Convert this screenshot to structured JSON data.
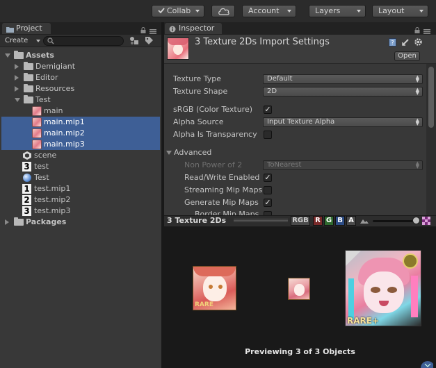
{
  "toolbar": {
    "collab_label": "Collab",
    "account_label": "Account",
    "layers_label": "Layers",
    "layout_label": "Layout",
    "colors": {
      "bg": "#2b2b2b",
      "button": "#4f4f4f"
    }
  },
  "project": {
    "tab_label": "Project",
    "create_label": "Create",
    "search": {
      "value": "",
      "placeholder": ""
    },
    "tree": [
      {
        "label": "Assets",
        "kind": "folder",
        "bold": true,
        "expanded": true
      },
      {
        "label": "Demigiant",
        "kind": "folder",
        "expanded": false
      },
      {
        "label": "Editor",
        "kind": "folder",
        "expanded": false
      },
      {
        "label": "Resources",
        "kind": "folder",
        "expanded": false
      },
      {
        "label": "Test",
        "kind": "folder",
        "expanded": true
      },
      {
        "label": "main",
        "kind": "texture",
        "selected": false
      },
      {
        "label": "main.mip1",
        "kind": "texture",
        "selected": true
      },
      {
        "label": "main.mip2",
        "kind": "texture",
        "selected": true
      },
      {
        "label": "main.mip3",
        "kind": "texture",
        "selected": true
      },
      {
        "label": "scene",
        "kind": "scene-icon"
      },
      {
        "label": "test",
        "kind": "number-icon",
        "glyph": "3"
      },
      {
        "label": "Test",
        "kind": "sphere-icon"
      },
      {
        "label": "test.mip1",
        "kind": "number-icon",
        "glyph": "1"
      },
      {
        "label": "test.mip2",
        "kind": "number-icon",
        "glyph": "2"
      },
      {
        "label": "test.mip3",
        "kind": "number-icon",
        "glyph": "3"
      },
      {
        "label": "Packages",
        "kind": "folder",
        "bold": true,
        "expanded": false
      }
    ]
  },
  "inspector": {
    "tab_label": "Inspector",
    "title": "3 Texture 2Ds Import Settings",
    "open_label": "Open",
    "fields": {
      "texture_type": {
        "label": "Texture Type",
        "value": "Default"
      },
      "texture_shape": {
        "label": "Texture Shape",
        "value": "2D"
      },
      "srgb": {
        "label": "sRGB (Color Texture)",
        "checked": true
      },
      "alpha_source": {
        "label": "Alpha Source",
        "value": "Input Texture Alpha"
      },
      "alpha_transparency": {
        "label": "Alpha Is Transparency",
        "checked": false
      },
      "advanced": {
        "label": "Advanced"
      },
      "non_power_of_2": {
        "label": "Non Power of 2",
        "value": "ToNearest"
      },
      "read_write": {
        "label": "Read/Write Enabled",
        "checked": true
      },
      "streaming_mips": {
        "label": "Streaming Mip Maps",
        "checked": false
      },
      "generate_mips": {
        "label": "Generate Mip Maps",
        "checked": true
      },
      "border_mips": {
        "label": "Border Mip Maps",
        "checked": false
      }
    }
  },
  "preview": {
    "title": "3 Texture 2Ds",
    "channels": [
      "RGB",
      "R",
      "G",
      "B",
      "A"
    ],
    "channel_colors": {
      "RGB": "#4a4a4a",
      "R": "#7a2a2a",
      "G": "#2f6a2f",
      "B": "#2d4d86",
      "A": "#4a4a4a"
    },
    "mip_level": 0.95,
    "caption": "Previewing 3 of 3 Objects",
    "thumb_badge": "RARE+",
    "thumb_badge_small": "RARE"
  },
  "colors": {
    "panel_bg": "#383838",
    "selection": "#3e5f96",
    "preview_bg": "#191919"
  }
}
